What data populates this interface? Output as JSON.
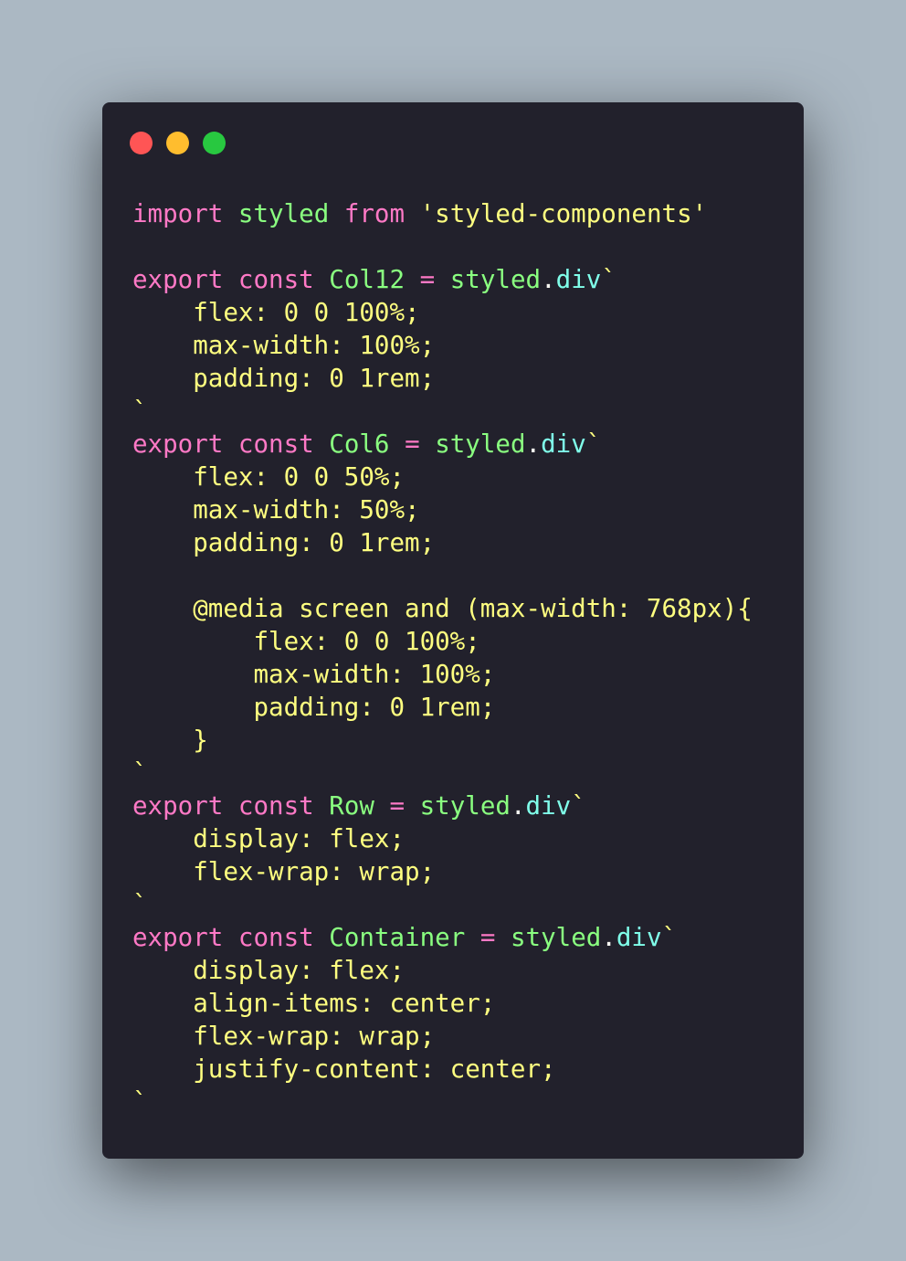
{
  "window": {
    "background": "#22212c",
    "page_background": "#abb8c3",
    "controls": [
      {
        "name": "close-dot",
        "color": "#ff5555"
      },
      {
        "name": "minimize-dot",
        "color": "#ffbd2e"
      },
      {
        "name": "maximize-dot",
        "color": "#28c840"
      }
    ]
  },
  "colors": {
    "keyword": "#ff79c6",
    "ident": "#8aff80",
    "string": "#ffff80",
    "property": "#80ffea",
    "plain": "#f8f8f2"
  },
  "code": {
    "language": "javascript",
    "lines": [
      [
        [
          "import",
          "keyword"
        ],
        [
          " ",
          "plain"
        ],
        [
          "styled",
          "ident"
        ],
        [
          " ",
          "plain"
        ],
        [
          "from",
          "keyword"
        ],
        [
          " ",
          "plain"
        ],
        [
          "'styled-components'",
          "string"
        ]
      ],
      [],
      [
        [
          "export",
          "keyword"
        ],
        [
          " ",
          "plain"
        ],
        [
          "const",
          "keyword"
        ],
        [
          " ",
          "plain"
        ],
        [
          "Col12",
          "ident"
        ],
        [
          " ",
          "plain"
        ],
        [
          "=",
          "keyword"
        ],
        [
          " ",
          "plain"
        ],
        [
          "styled",
          "ident"
        ],
        [
          ".",
          "plain"
        ],
        [
          "div",
          "property"
        ],
        [
          "`",
          "string"
        ]
      ],
      [
        [
          "    flex: 0 0 100%;",
          "string"
        ]
      ],
      [
        [
          "    max-width: 100%;",
          "string"
        ]
      ],
      [
        [
          "    padding: 0 1rem;",
          "string"
        ]
      ],
      [
        [
          "`",
          "string"
        ]
      ],
      [
        [
          "export",
          "keyword"
        ],
        [
          " ",
          "plain"
        ],
        [
          "const",
          "keyword"
        ],
        [
          " ",
          "plain"
        ],
        [
          "Col6",
          "ident"
        ],
        [
          " ",
          "plain"
        ],
        [
          "=",
          "keyword"
        ],
        [
          " ",
          "plain"
        ],
        [
          "styled",
          "ident"
        ],
        [
          ".",
          "plain"
        ],
        [
          "div",
          "property"
        ],
        [
          "`",
          "string"
        ]
      ],
      [
        [
          "    flex: 0 0 50%;",
          "string"
        ]
      ],
      [
        [
          "    max-width: 50%;",
          "string"
        ]
      ],
      [
        [
          "    padding: 0 1rem;",
          "string"
        ]
      ],
      [],
      [
        [
          "    @media screen and (max-width: 768px){",
          "string"
        ]
      ],
      [
        [
          "        flex: 0 0 100%;",
          "string"
        ]
      ],
      [
        [
          "        max-width: 100%;",
          "string"
        ]
      ],
      [
        [
          "        padding: 0 1rem;",
          "string"
        ]
      ],
      [
        [
          "    }",
          "string"
        ]
      ],
      [
        [
          "`",
          "string"
        ]
      ],
      [
        [
          "export",
          "keyword"
        ],
        [
          " ",
          "plain"
        ],
        [
          "const",
          "keyword"
        ],
        [
          " ",
          "plain"
        ],
        [
          "Row",
          "ident"
        ],
        [
          " ",
          "plain"
        ],
        [
          "=",
          "keyword"
        ],
        [
          " ",
          "plain"
        ],
        [
          "styled",
          "ident"
        ],
        [
          ".",
          "plain"
        ],
        [
          "div",
          "property"
        ],
        [
          "`",
          "string"
        ]
      ],
      [
        [
          "    display: flex;",
          "string"
        ]
      ],
      [
        [
          "    flex-wrap: wrap;",
          "string"
        ]
      ],
      [
        [
          "`",
          "string"
        ]
      ],
      [
        [
          "export",
          "keyword"
        ],
        [
          " ",
          "plain"
        ],
        [
          "const",
          "keyword"
        ],
        [
          " ",
          "plain"
        ],
        [
          "Container",
          "ident"
        ],
        [
          " ",
          "plain"
        ],
        [
          "=",
          "keyword"
        ],
        [
          " ",
          "plain"
        ],
        [
          "styled",
          "ident"
        ],
        [
          ".",
          "plain"
        ],
        [
          "div",
          "property"
        ],
        [
          "`",
          "string"
        ]
      ],
      [
        [
          "    display: flex;",
          "string"
        ]
      ],
      [
        [
          "    align-items: center;",
          "string"
        ]
      ],
      [
        [
          "    flex-wrap: wrap;",
          "string"
        ]
      ],
      [
        [
          "    justify-content: center;",
          "string"
        ]
      ],
      [
        [
          "`",
          "string"
        ]
      ]
    ]
  }
}
